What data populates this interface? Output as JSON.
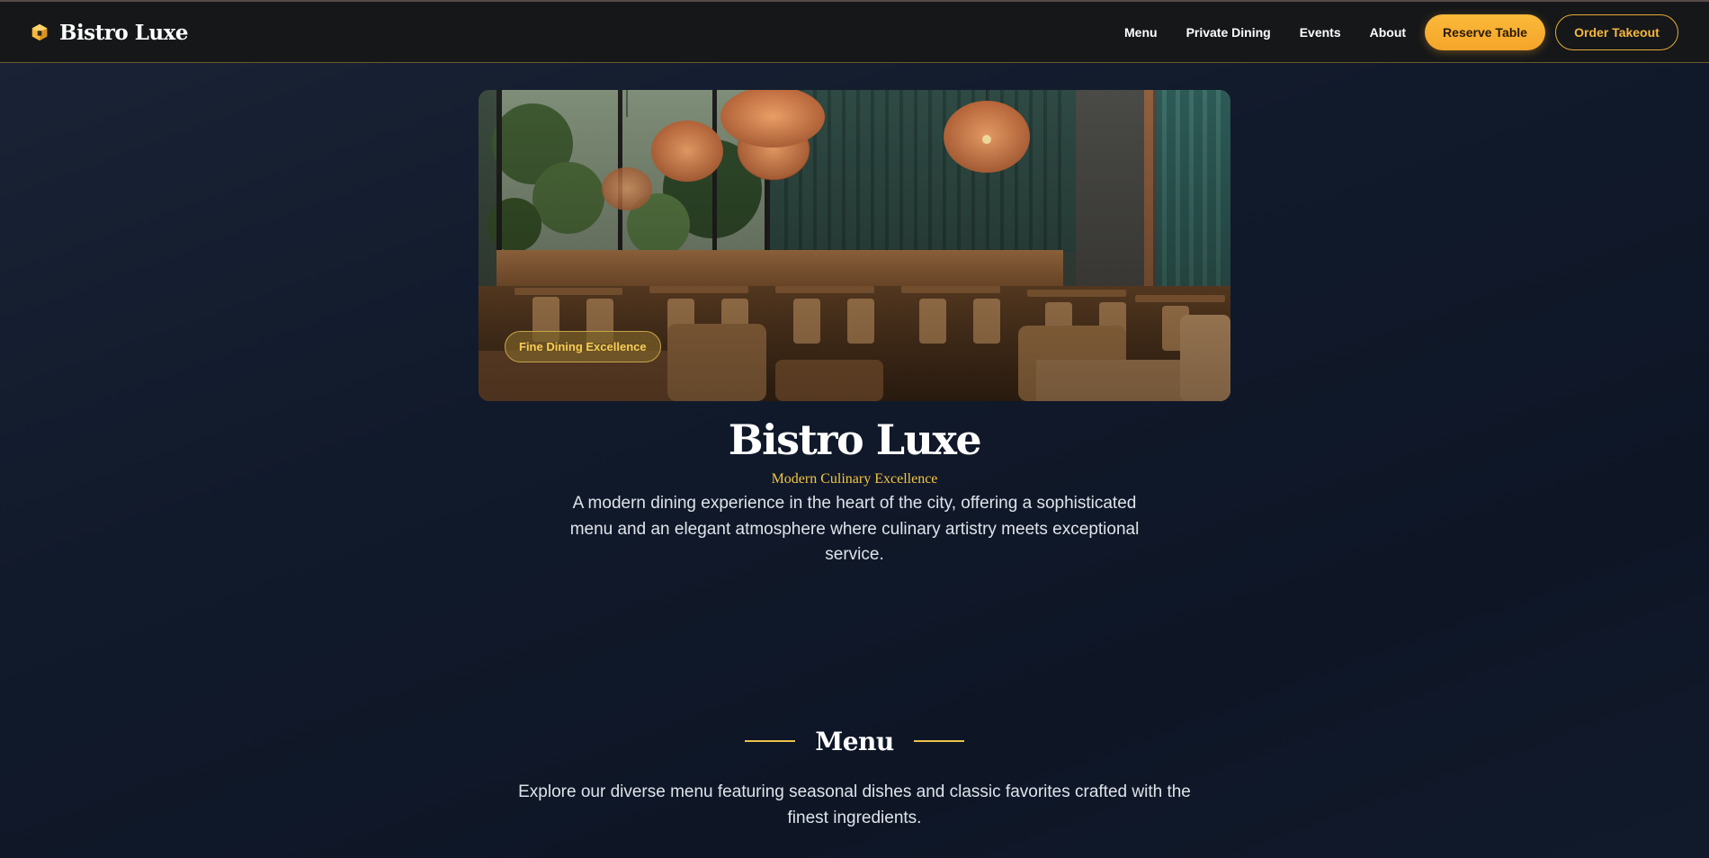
{
  "header": {
    "brand_name": "Bistro Luxe",
    "brand_icon": "cube-icon",
    "nav": [
      "Menu",
      "Private Dining",
      "Events",
      "About"
    ],
    "reserve_label": "Reserve Table",
    "order_label": "Order Takeout"
  },
  "hero": {
    "badge": "Fine Dining Excellence",
    "title": "Bistro Luxe",
    "subtitle": "Modern Culinary Excellence",
    "description": "A modern dining experience in the heart of the city, offering a sophisticated menu and an elegant atmosphere where culinary artistry meets exceptional service."
  },
  "menu_section": {
    "title": "Menu",
    "description": "Explore our diverse menu featuring seasonal dishes and classic favorites crafted with the finest ingredients."
  },
  "colors": {
    "accent": "#f6b73c",
    "gold_text": "#f3c545",
    "header_bg": "#151719",
    "page_bg": "#111a2b"
  }
}
